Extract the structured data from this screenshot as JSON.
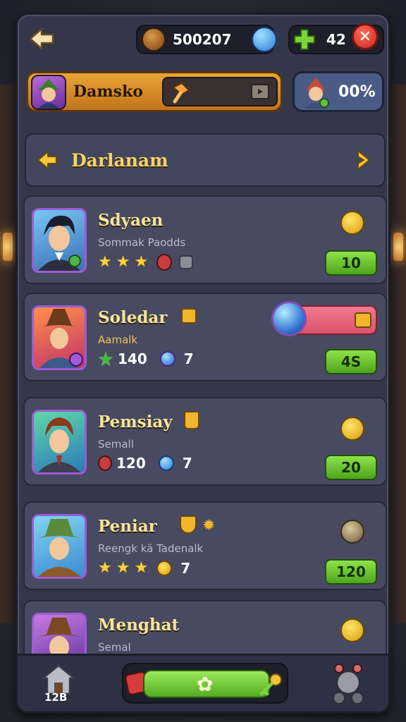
{
  "topbar": {
    "coins": "500207",
    "gems": "42"
  },
  "player": {
    "name": "Damsko",
    "percent": "00%"
  },
  "category": {
    "title": "Darlanam"
  },
  "cards": [
    {
      "name": "Sdyaen",
      "subtitle": "Sommak Paodds",
      "rating": 3,
      "price": "10"
    },
    {
      "name": "Soledar",
      "subtitle": "Aamalk",
      "stat1": "140",
      "stat2": "7",
      "price": "4S"
    },
    {
      "name": "Pemsiay",
      "subtitle": "Semall",
      "stat1": "120",
      "stat2": "7",
      "price": "20"
    },
    {
      "name": "Peniar",
      "subtitle": "Reengk kä Tadenalk",
      "rating": 3,
      "stat2": "7",
      "price": "120"
    },
    {
      "name": "Menghat",
      "subtitle": "Semal"
    }
  ],
  "bottom": {
    "house_label": "12B"
  },
  "colors": {
    "accent": "#f6d266",
    "green": "#6cc531",
    "frame": "#34374a"
  }
}
